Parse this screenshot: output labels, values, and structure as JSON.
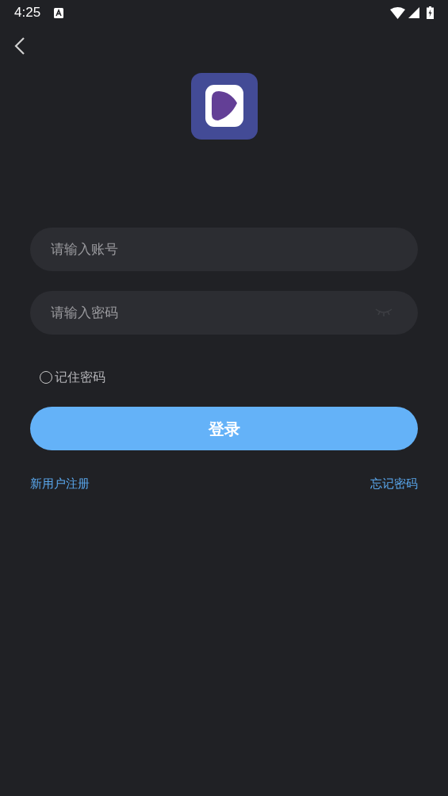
{
  "status_bar": {
    "time": "4:25"
  },
  "form": {
    "account_field": {
      "placeholder": "请输入账号"
    },
    "password_field": {
      "placeholder": "请输入密码"
    },
    "remember": {
      "label": "记住密码",
      "checked": false
    },
    "login_button": "登录",
    "links": [
      "新用户注册",
      "忘记密码"
    ]
  }
}
